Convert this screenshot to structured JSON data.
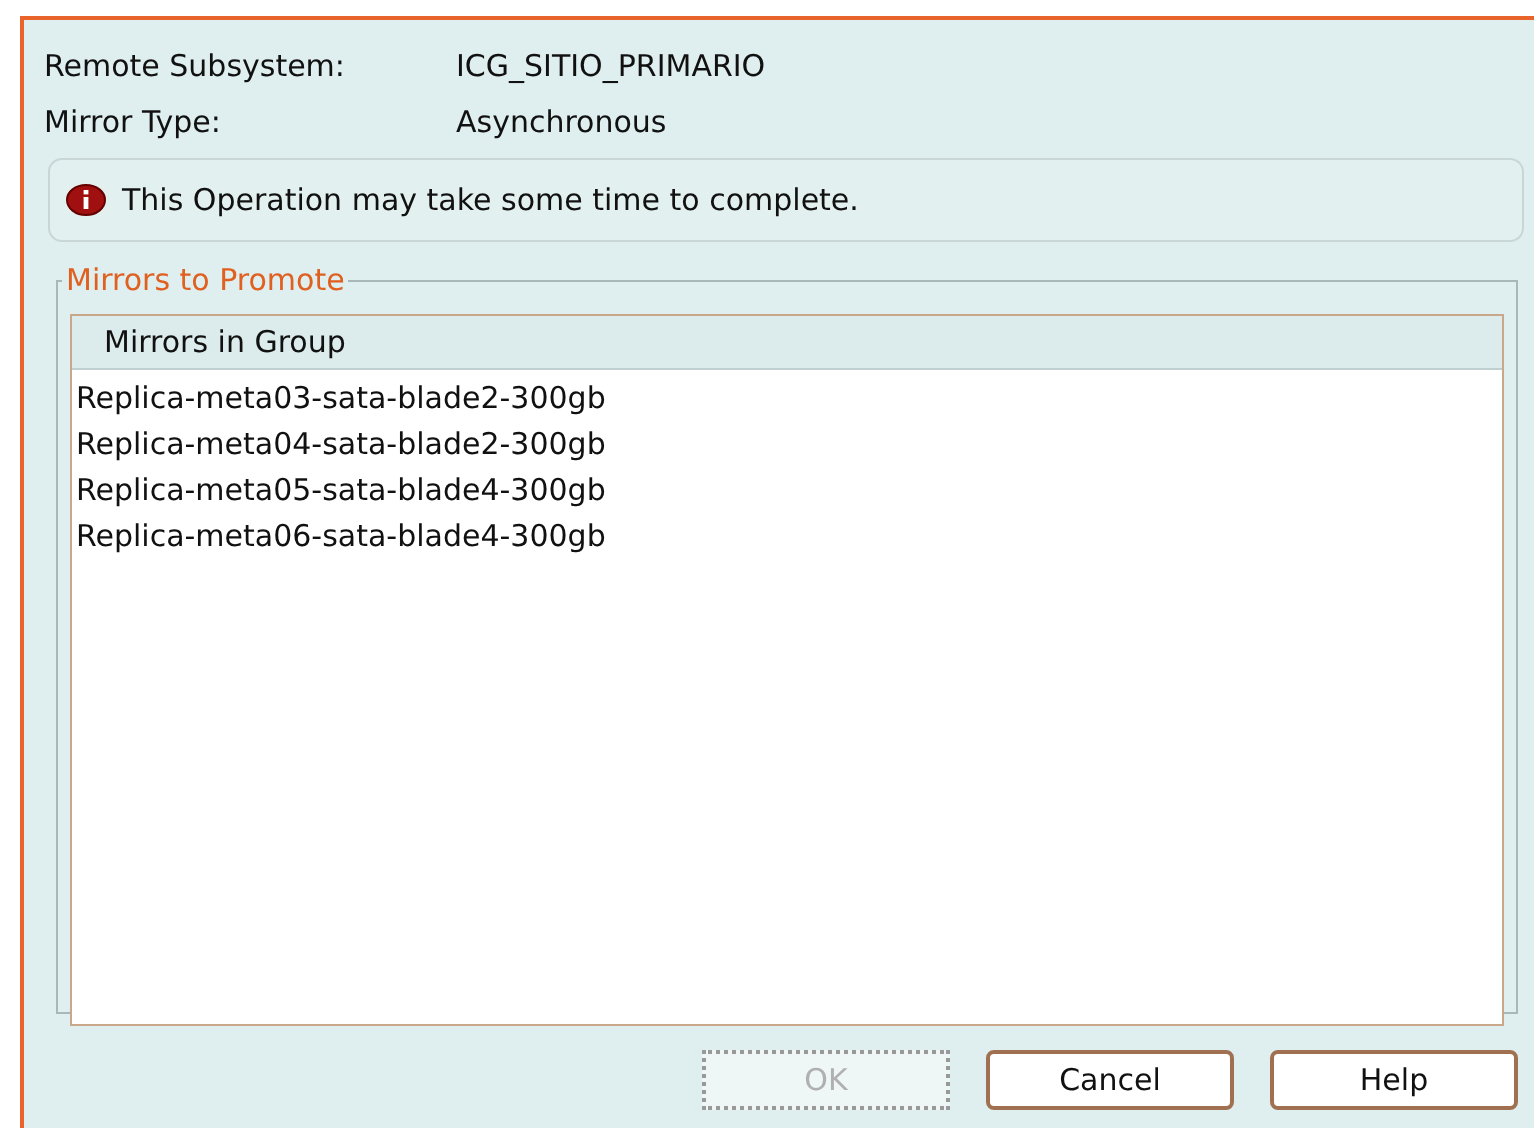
{
  "fields": [
    {
      "label": "Remote Subsystem:",
      "value": "ICG_SITIO_PRIMARIO"
    },
    {
      "label": "Mirror Type:",
      "value": "Asynchronous"
    }
  ],
  "notice": {
    "text": "This Operation may take some time to complete."
  },
  "group": {
    "title": "Mirrors to Promote",
    "column": "Mirrors in Group",
    "rows": [
      "Replica-meta03-sata-blade2-300gb",
      "Replica-meta04-sata-blade2-300gb",
      "Replica-meta05-sata-blade4-300gb",
      "Replica-meta06-sata-blade4-300gb"
    ]
  },
  "buttons": [
    {
      "label": "OK",
      "disabled": true
    },
    {
      "label": "Cancel",
      "disabled": false
    },
    {
      "label": "Help",
      "disabled": false
    }
  ]
}
